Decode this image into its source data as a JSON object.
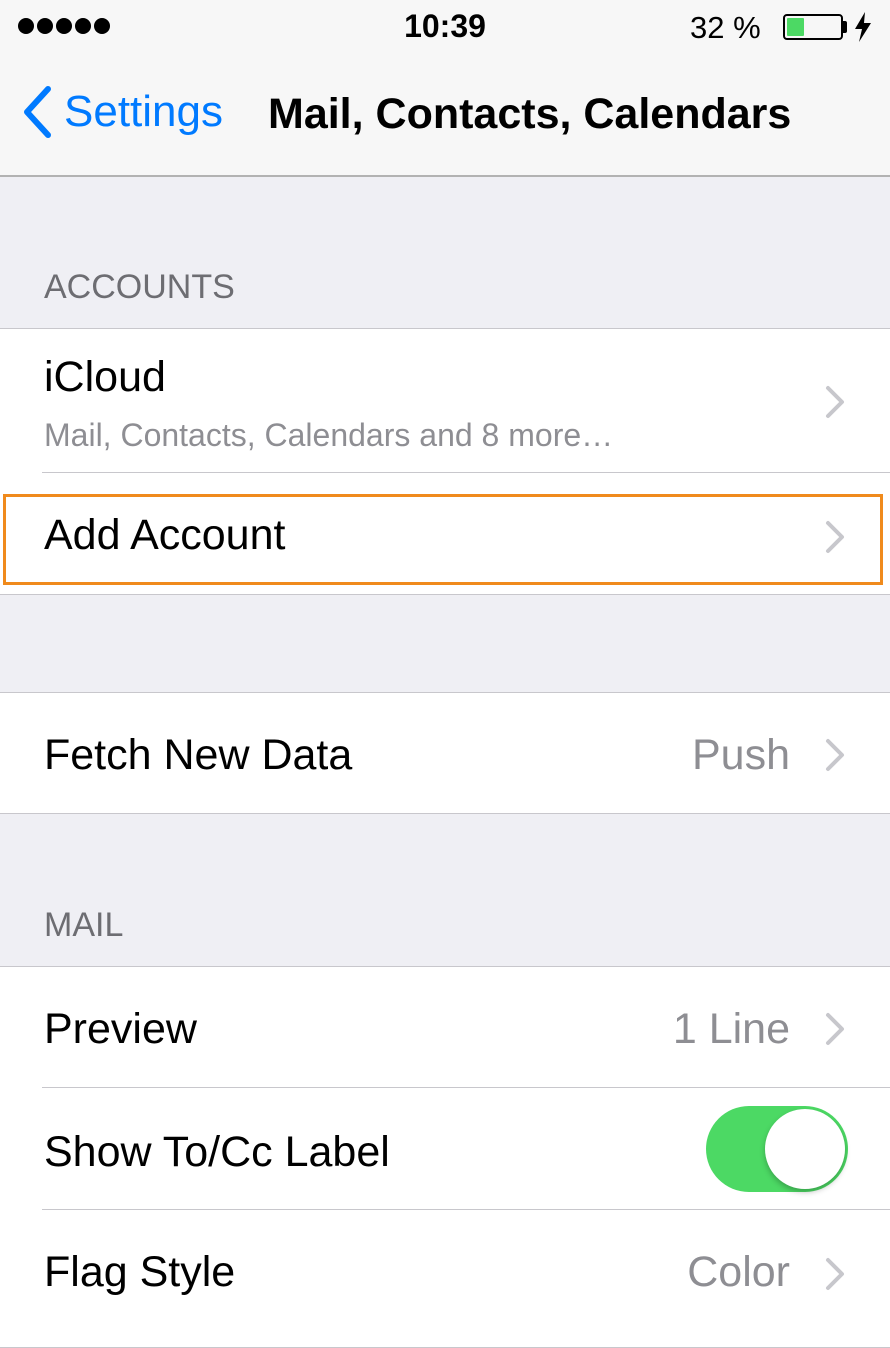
{
  "status_bar": {
    "time": "10:39",
    "battery_pct": "32 %",
    "battery_level": 0.32
  },
  "nav": {
    "back_label": "Settings",
    "title": "Mail, Contacts, Calendars"
  },
  "accounts": {
    "header": "ACCOUNTS",
    "icloud": {
      "label": "iCloud",
      "detail": "Mail, Contacts, Calendars and 8 more…"
    },
    "add_account": {
      "label": "Add Account"
    }
  },
  "fetch": {
    "label": "Fetch New Data",
    "value": "Push"
  },
  "mail": {
    "header": "MAIL",
    "preview": {
      "label": "Preview",
      "value": "1 Line"
    },
    "show_to_cc": {
      "label": "Show To/Cc Label",
      "on": true
    },
    "flag_style": {
      "label": "Flag Style",
      "value": "Color"
    }
  },
  "colors": {
    "accent": "#007aff",
    "toggle_on": "#4cd964",
    "highlight": "#f08a1c"
  }
}
